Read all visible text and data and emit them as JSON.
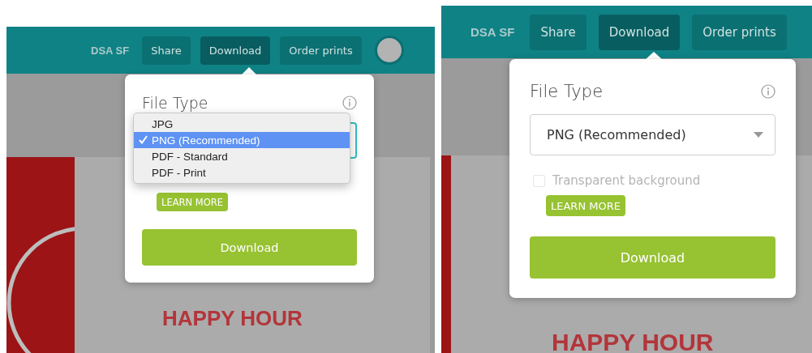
{
  "panels": [
    {
      "kind": "compact",
      "header": {
        "brand": "DSA SF",
        "avatar": true,
        "buttons": [
          {
            "label": "Share",
            "selected": false
          },
          {
            "label": "Download",
            "selected": true
          },
          {
            "label": "Order prints",
            "selected": false
          }
        ]
      },
      "popover": {
        "title": "File Type",
        "select": {
          "expanded": true,
          "options": [
            {
              "label": "JPG",
              "selected": false
            },
            {
              "label": "PNG (Recommended)",
              "selected": true
            },
            {
              "label": "PDF - Standard",
              "selected": false
            },
            {
              "label": "PDF - Print",
              "selected": false
            }
          ]
        },
        "learn_more": "LEARN MORE",
        "download": "Download"
      },
      "design": {
        "headline": "HAPPY HOUR"
      }
    },
    {
      "kind": "zoomed",
      "header": {
        "brand": "DSA SF",
        "buttons": [
          {
            "label": "Share",
            "selected": false
          },
          {
            "label": "Download",
            "selected": true
          },
          {
            "label": "Order prints",
            "selected": false
          }
        ]
      },
      "popover": {
        "title": "File Type",
        "select": {
          "expanded": false,
          "value": "PNG (Recommended)"
        },
        "checkbox": {
          "label": "Transparent background",
          "checked": false,
          "disabled": true
        },
        "learn_more": "LEARN MORE",
        "download": "Download"
      },
      "design": {
        "headline": "HAPPY HOUR"
      }
    }
  ]
}
